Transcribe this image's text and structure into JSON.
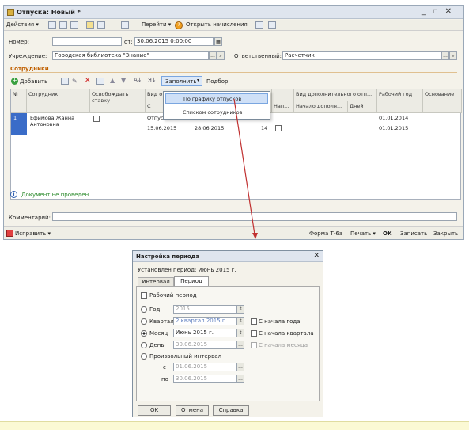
{
  "doc_window": {
    "title": "Отпуска: Новый *",
    "toolbar": {
      "actions": "Действия",
      "go": "Перейти",
      "open_accruals": "Открыть начисления"
    },
    "number_label": "Номер:",
    "number_value": "",
    "date_label": "от:",
    "date_value": "30.06.2015 0:00:00",
    "institution_label": "Учреждение:",
    "institution_value": "Городская библиотека \"Знание\"",
    "responsible_label": "Ответственный:",
    "responsible_value": "Расчетчик",
    "section_title": "Сотрудники",
    "grid_toolbar": {
      "add": "Добавить",
      "fill": "Заполнить",
      "pick": "Подбор"
    },
    "columns": {
      "n": "№",
      "employee": "Сотрудник",
      "release": "Освобождать ставку",
      "vid": "Вид от",
      "s": "С",
      "extra": "Вид дополнительного отп...",
      "nap": "Нап...",
      "start_extra": "Начало дополн...",
      "days": "Дней",
      "work_year": "Рабочий год",
      "basis": "Основание"
    },
    "rows": [
      {
        "n": "1",
        "employee": "Ефимова Жанна Антоновна",
        "vid": "Отпуск ежегодный",
        "from": "15.06.2015",
        "to": "28.06.2015",
        "days": "14",
        "wy_from": "01.01.2014",
        "wy_to": "01.01.2015"
      }
    ],
    "fill_menu": [
      "По графику отпусков",
      "Списком сотрудников"
    ],
    "not_posted": "Документ не проведен",
    "comment_label": "Комментарий:",
    "comment_value": "",
    "footer": {
      "fix": "Исправить",
      "form": "Форма Т-6а",
      "print": "Печать",
      "ok": "OK",
      "save": "Записать",
      "close": "Закрыть"
    }
  },
  "period_dialog": {
    "title": "Настройка периода",
    "set_period": "Установлен период: Июнь 2015 г.",
    "tabs": [
      "Интервал",
      "Период"
    ],
    "work_period": "Рабочий период",
    "year_label": "Год",
    "year_value": "2015",
    "quarter_label": "Квартал",
    "quarter_value": "2 квартал 2015 г.",
    "month_label": "Месяц",
    "month_value": "Июнь 2015 г.",
    "day_label": "День",
    "day_value": "30.06.2015",
    "from_year_start": "С начала года",
    "from_quarter_start": "С начала квартала",
    "from_month_start": "С начала месяца",
    "arbitrary": "Произвольный интервал",
    "from_label": "с",
    "from_value": "01.06.2015",
    "to_label": "по",
    "to_value": "30.06.2015",
    "buttons": {
      "ok": "OK",
      "cancel": "Отмена",
      "help": "Справка"
    }
  },
  "colors": {
    "accent": "#c06000",
    "arrow": "#c03030",
    "selection": "#cfe0f7"
  }
}
